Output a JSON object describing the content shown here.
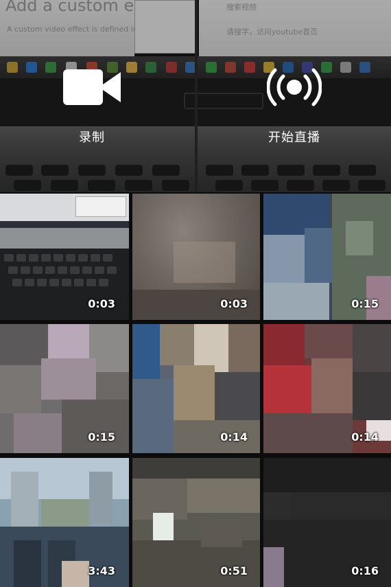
{
  "actions": {
    "record": {
      "label": "录制",
      "icon": "video-camera-icon"
    },
    "live": {
      "label": "开始直播",
      "icon": "live-broadcast-icon"
    }
  },
  "preview": {
    "screen_left_heading": "Add a custom effect t",
    "screen_left_line": "A custom video effect is defined in a c",
    "screen_right_line1": "搜索视频",
    "screen_right_line2": "请搜字，访问youtube首页"
  },
  "videos": [
    {
      "duration": "0:03"
    },
    {
      "duration": "0:03"
    },
    {
      "duration": "0:15"
    },
    {
      "duration": "0:15"
    },
    {
      "duration": "0:14"
    },
    {
      "duration": "0:14"
    },
    {
      "duration": "3:43"
    },
    {
      "duration": "0:51"
    },
    {
      "duration": "0:16"
    }
  ],
  "colors": {
    "text": "#ffffff",
    "background": "#0c0c0c"
  }
}
